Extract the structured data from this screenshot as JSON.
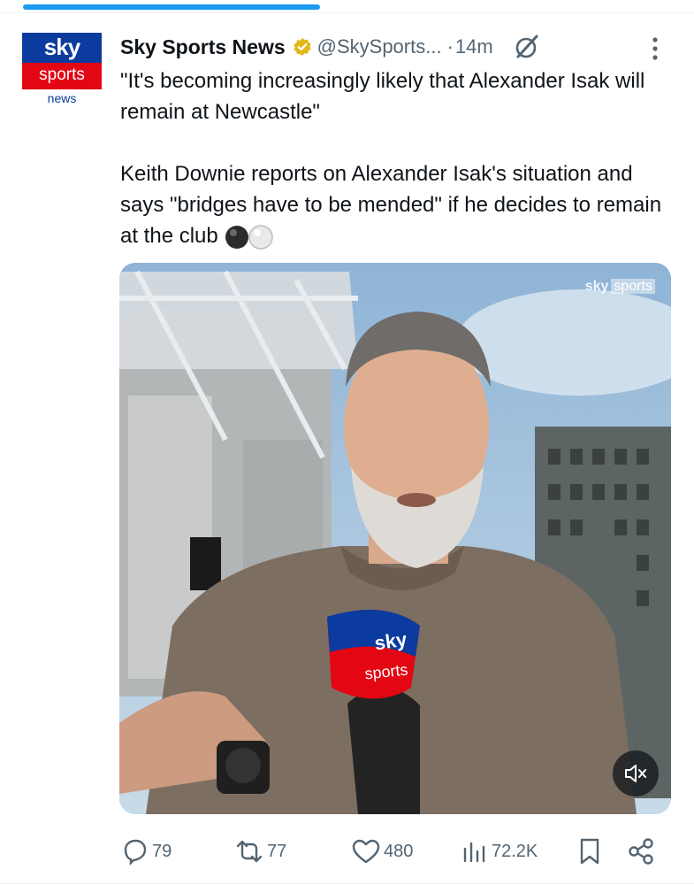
{
  "post": {
    "author_name": "Sky Sports News",
    "handle": "@SkySports...",
    "separator": "·",
    "time": "14m",
    "text_line1": "\"It's becoming increasingly likely that Alexander Isak will remain at Newcastle\"",
    "text_line2": "Keith Downie reports on Alexander Isak's situation and says \"bridges have to be mended\" if he decides to remain at the club"
  },
  "avatar": {
    "line1": "sky",
    "line2": "sports",
    "line3": "news"
  },
  "media": {
    "watermark_brand": "sky",
    "watermark_sub": "sports",
    "mic_line1": "sky",
    "mic_line2": "sports"
  },
  "actions": {
    "replies": "79",
    "reposts": "77",
    "likes": "480",
    "views": "72.2K"
  },
  "icons": [
    "verified-badge-icon",
    "grok-icon",
    "more-icon",
    "reply-icon",
    "repost-icon",
    "like-icon",
    "views-icon",
    "bookmark-icon",
    "share-icon",
    "mute-icon"
  ],
  "colors": {
    "accent": "#1d9bf0",
    "brand_blue": "#0b3b9e",
    "brand_red": "#e30613",
    "muted": "#536471"
  }
}
